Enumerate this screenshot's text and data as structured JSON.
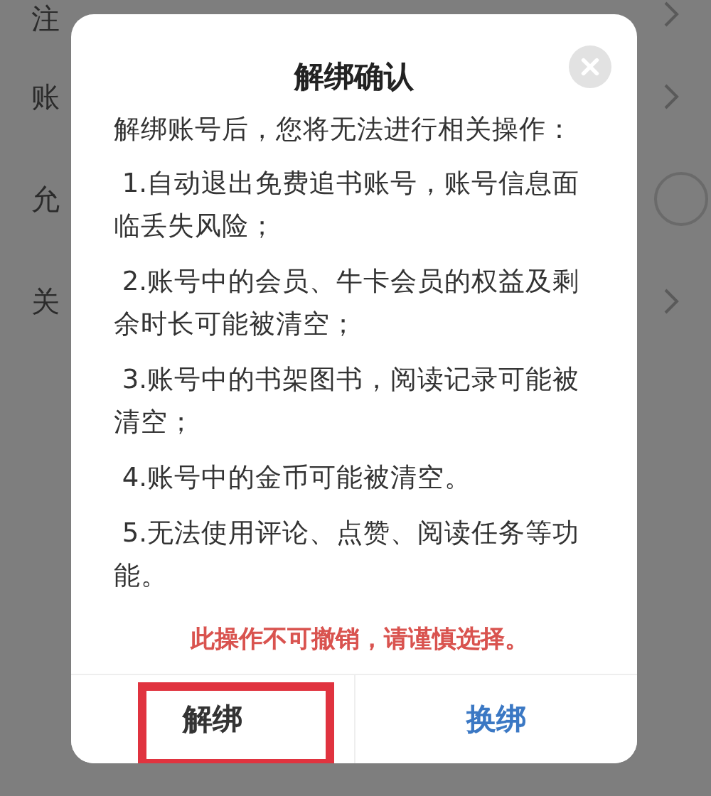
{
  "background_list": [
    {
      "label": "注",
      "kind": "chevron"
    },
    {
      "label": "账",
      "kind": "chevron"
    },
    {
      "label": "允",
      "kind": "toggle",
      "on": false
    },
    {
      "label": "关",
      "kind": "chevron"
    }
  ],
  "dialog": {
    "title": "解绑确认",
    "intro": "解绑账号后，您将无法进行相关操作：",
    "items": [
      " 1.自动退出免费追书账号，账号信息面临丢失风险；",
      " 2.账号中的会员、牛卡会员的权益及剩余时长可能被清空；",
      " 3.账号中的书架图书，阅读记录可能被清空；",
      " 4.账号中的金币可能被清空。",
      " 5.无法使用评论、点赞、阅读任务等功能。"
    ],
    "warning": "此操作不可撤销，请谨慎选择。",
    "buttons": [
      {
        "label": "解绑",
        "kind": "plain",
        "highlighted": true
      },
      {
        "label": "换绑",
        "kind": "primary",
        "highlighted": false
      }
    ]
  }
}
